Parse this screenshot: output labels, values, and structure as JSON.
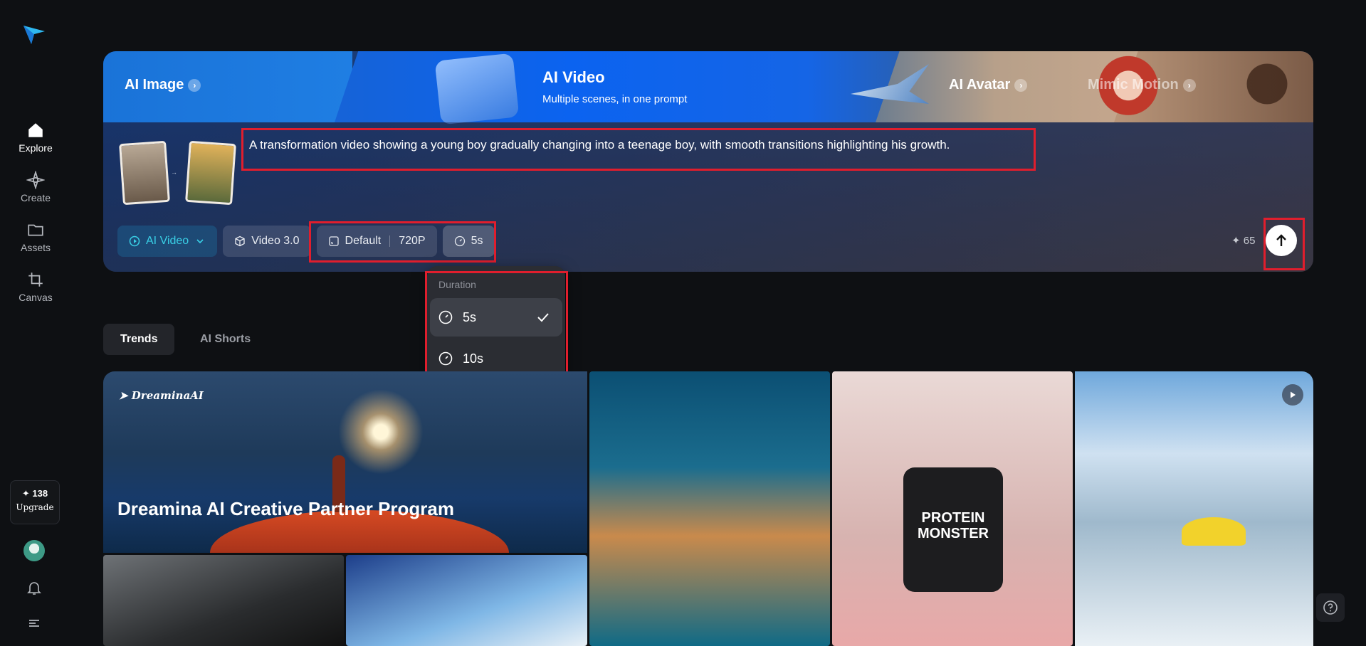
{
  "sidebar": {
    "items": [
      {
        "label": "Explore",
        "icon": "home-icon"
      },
      {
        "label": "Create",
        "icon": "sparkle-icon"
      },
      {
        "label": "Assets",
        "icon": "folder-icon"
      },
      {
        "label": "Canvas",
        "icon": "crop-icon"
      }
    ],
    "credits": "✦ 138",
    "upgrade": "Upgrade"
  },
  "hero": {
    "tabs": {
      "ai_image": "AI Image",
      "ai_video": "AI Video",
      "ai_video_sub": "Multiple scenes, in one prompt",
      "ai_avatar": "AI Avatar",
      "mimic_motion": "Mimic Motion"
    },
    "prompt": "A transformation video showing a young boy gradually changing into a teenage boy, with smooth transitions highlighting his growth.",
    "toolbar": {
      "mode": "AI Video",
      "model": "Video 3.0",
      "ratio": "Default",
      "resolution": "720P",
      "duration": "5s"
    },
    "cost": "✦ 65"
  },
  "dropdown": {
    "title": "Duration",
    "options": [
      "5s",
      "10s"
    ],
    "selected": "5s"
  },
  "tabs": {
    "trends": "Trends",
    "shorts": "AI Shorts"
  },
  "gallery": {
    "promo_brand": "DreaminaAI",
    "promo_title": "Dreamina AI Creative Partner Program",
    "protein_label": "PROTEIN MONSTER"
  },
  "colors": {
    "accent": "#39d0e6",
    "highlight": "#e01e2d",
    "background": "#0e1013"
  }
}
